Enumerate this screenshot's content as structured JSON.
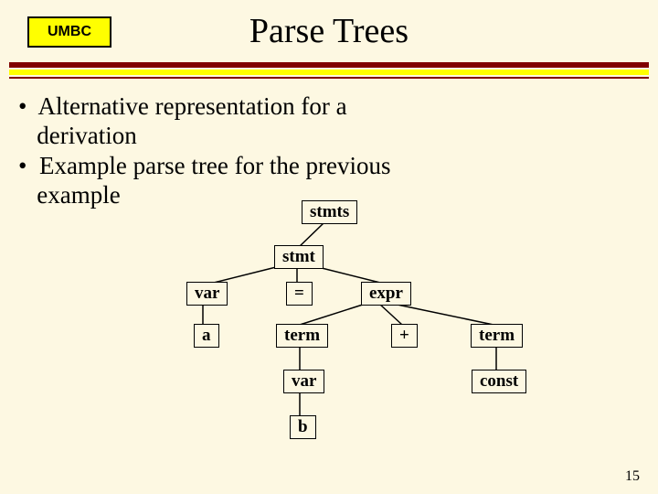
{
  "badge": "UMBC",
  "title": "Parse Trees",
  "bullets": {
    "line1": "•  Alternative representation for a",
    "line2": "   derivation",
    "line3": "•  Example parse tree for the previous",
    "line4": "   example"
  },
  "tree": {
    "stmts": "stmts",
    "stmt": "stmt",
    "var1": "var",
    "eq": "=",
    "expr": "expr",
    "a": "a",
    "term1": "term",
    "plus": "+",
    "term2": "term",
    "var2": "var",
    "const": "const",
    "b": "b"
  },
  "pagenum": "15"
}
